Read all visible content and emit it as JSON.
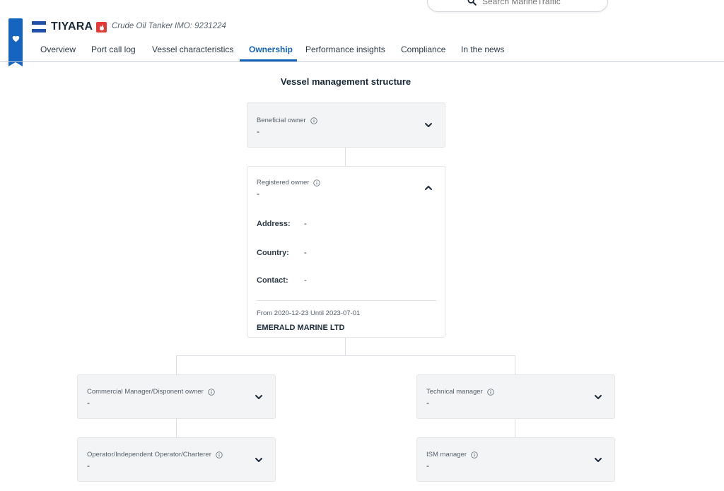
{
  "search": {
    "placeholder": "Search MarineTraffic"
  },
  "vessel": {
    "name": "TIYARA",
    "type": "Crude Oil Tanker",
    "imo": "IMO: 9231224"
  },
  "tabs": [
    {
      "label": "Overview"
    },
    {
      "label": "Port call log"
    },
    {
      "label": "Vessel characteristics"
    },
    {
      "label": "Ownership",
      "active": true
    },
    {
      "label": "Performance insights"
    },
    {
      "label": "Compliance"
    },
    {
      "label": "In the news"
    }
  ],
  "structure": {
    "title": "Vessel management structure",
    "beneficial_owner": {
      "label": "Beneficial owner",
      "value": "-"
    },
    "registered_owner": {
      "label": "Registered owner",
      "value": "-",
      "address_label": "Address:",
      "address_value": "-",
      "country_label": "Country:",
      "country_value": "-",
      "contact_label": "Contact:",
      "contact_value": "-",
      "period": "From 2020-12-23 Until 2023-07-01",
      "company": "EMERALD MARINE LTD"
    },
    "commercial_manager": {
      "label": "Commercial Manager/Disponent owner",
      "value": "-"
    },
    "technical_manager": {
      "label": "Technical manager",
      "value": "-"
    },
    "operator": {
      "label": "Operator/Independent Operator/Charterer",
      "value": "-"
    },
    "ism_manager": {
      "label": "ISM manager",
      "value": "-"
    }
  },
  "colors": {
    "accent": "#1565c0",
    "card_bg": "#f3f4f6",
    "tanker_badge": "#e53935"
  },
  "icons": {
    "search": "search-icon",
    "bookmark": "heart-icon",
    "info": "info-icon",
    "expand": "chevron-down-icon",
    "collapse": "chevron-up-icon"
  }
}
